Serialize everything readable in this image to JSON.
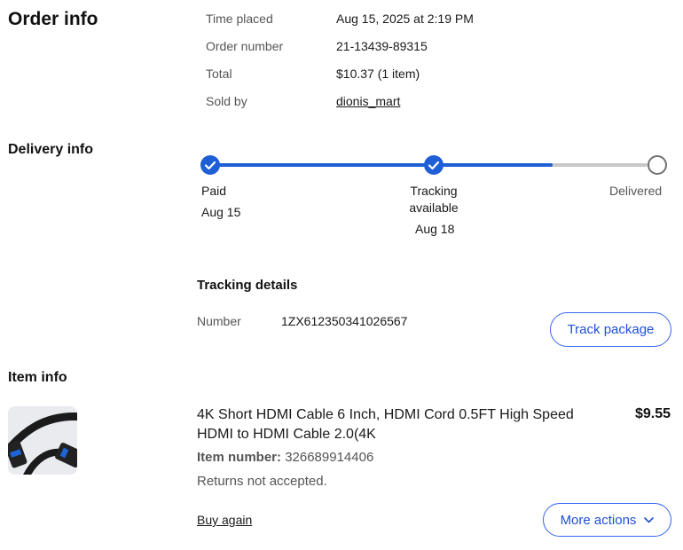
{
  "order_info": {
    "title": "Order info",
    "rows": [
      {
        "label": "Time placed",
        "value": "Aug 15, 2025 at 2:19 PM"
      },
      {
        "label": "Order number",
        "value": "21-13439-89315"
      },
      {
        "label": "Total",
        "value": "$10.37 (1 item)"
      },
      {
        "label": "Sold by",
        "value": "dionis_mart"
      }
    ]
  },
  "delivery_info": {
    "title": "Delivery info",
    "steps": [
      {
        "label": "Paid",
        "date": "Aug 15",
        "status": "done"
      },
      {
        "label": "Tracking available",
        "date": "Aug 18",
        "status": "done"
      },
      {
        "label": "Delivered",
        "date": "",
        "status": "pending"
      }
    ],
    "progress_fraction": 0.78,
    "colors": {
      "done": "#1f5fd6",
      "pending": "#c7c7c7"
    }
  },
  "tracking": {
    "title": "Tracking details",
    "number_label": "Number",
    "number_value": "1ZX612350341026567",
    "track_button": "Track package"
  },
  "item_info": {
    "title": "Item info",
    "item": {
      "title": "4K Short HDMI Cable 6 Inch, HDMI Cord 0.5FT High Speed HDMI to HDMI Cable 2.0(4K",
      "item_number_label": "Item number:",
      "item_number_value": "326689914406",
      "returns": "Returns not accepted.",
      "price": "$9.55",
      "image_icon": "hdmi-cable-image"
    },
    "buy_again": "Buy again",
    "more_actions": "More actions"
  }
}
